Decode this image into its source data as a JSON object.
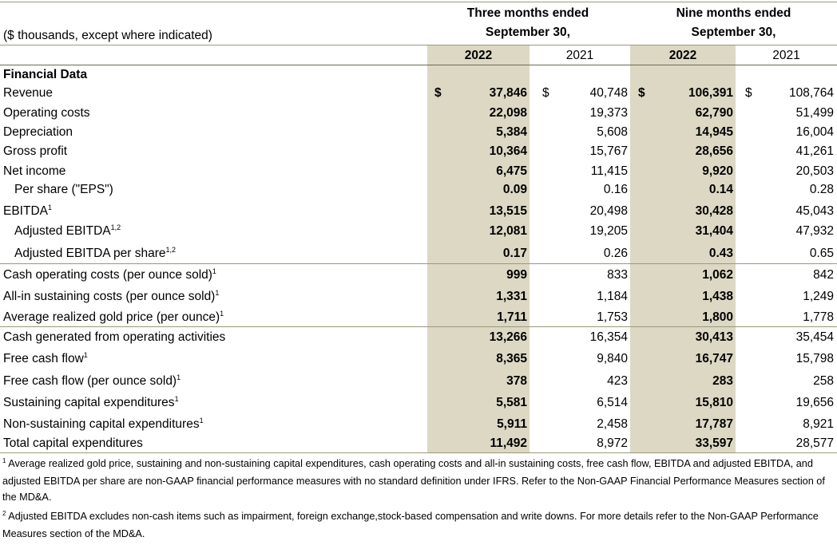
{
  "header": {
    "units_label": "($ thousands, except where indicated)",
    "three_months_line1": "Three months ended",
    "three_months_line2": "September 30,",
    "nine_months_line1": "Nine months ended",
    "nine_months_line2": "September 30,",
    "years": [
      "2022",
      "2021",
      "2022",
      "2021"
    ]
  },
  "colors": {
    "shade": "#dcd8c4",
    "rule": "#9a9a7a"
  },
  "section_title": "Financial Data",
  "currency_symbol": "$",
  "rows": [
    {
      "label": "Revenue",
      "sup": "",
      "indent": false,
      "currency": true,
      "values": [
        "37,846",
        "40,748",
        "106,391",
        "108,764"
      ]
    },
    {
      "label": "Operating costs",
      "sup": "",
      "indent": false,
      "currency": false,
      "values": [
        "22,098",
        "19,373",
        "62,790",
        "51,499"
      ]
    },
    {
      "label": "Depreciation",
      "sup": "",
      "indent": false,
      "currency": false,
      "values": [
        "5,384",
        "5,608",
        "14,945",
        "16,004"
      ]
    },
    {
      "label": "Gross profit",
      "sup": "",
      "indent": false,
      "currency": false,
      "values": [
        "10,364",
        "15,767",
        "28,656",
        "41,261"
      ]
    },
    {
      "label": "Net income",
      "sup": "",
      "indent": false,
      "currency": false,
      "values": [
        "6,475",
        "11,415",
        "9,920",
        "20,503"
      ]
    },
    {
      "label": "Per share (\"EPS\")",
      "sup": "",
      "indent": true,
      "currency": false,
      "values": [
        "0.09",
        "0.16",
        "0.14",
        "0.28"
      ]
    },
    {
      "label": "EBITDA",
      "sup": "1",
      "indent": false,
      "currency": false,
      "values": [
        "13,515",
        "20,498",
        "30,428",
        "45,043"
      ]
    },
    {
      "label": "Adjusted EBITDA",
      "sup": "1,2",
      "indent": true,
      "currency": false,
      "values": [
        "12,081",
        "19,205",
        "31,404",
        "47,932"
      ]
    },
    {
      "label": "Adjusted EBITDA per share",
      "sup": "1,2",
      "indent": true,
      "currency": false,
      "values": [
        "0.17",
        "0.26",
        "0.43",
        "0.65"
      ]
    },
    {
      "label": "Cash operating costs (per ounce sold)",
      "sup": "1",
      "indent": false,
      "currency": false,
      "values": [
        "999",
        "833",
        "1,062",
        "842"
      ]
    },
    {
      "label": "All-in sustaining costs (per ounce sold)",
      "sup": "1",
      "indent": false,
      "currency": false,
      "values": [
        "1,331",
        "1,184",
        "1,438",
        "1,249"
      ]
    },
    {
      "label": "Average realized gold price (per ounce)",
      "sup": "1",
      "indent": false,
      "currency": false,
      "values": [
        "1,711",
        "1,753",
        "1,800",
        "1,778"
      ]
    },
    {
      "label": "Cash generated from operating activities",
      "sup": "",
      "indent": false,
      "currency": false,
      "values": [
        "13,266",
        "16,354",
        "30,413",
        "35,454"
      ]
    },
    {
      "label": "Free cash flow",
      "sup": "1",
      "indent": false,
      "currency": false,
      "values": [
        "8,365",
        "9,840",
        "16,747",
        "15,798"
      ]
    },
    {
      "label": "Free cash flow (per ounce sold)",
      "sup": "1",
      "indent": false,
      "currency": false,
      "values": [
        "378",
        "423",
        "283",
        "258"
      ]
    },
    {
      "label": "Sustaining capital expenditures",
      "sup": "1",
      "indent": false,
      "currency": false,
      "values": [
        "5,581",
        "6,514",
        "15,810",
        "19,656"
      ]
    },
    {
      "label": "Non-sustaining capital expenditures",
      "sup": "1",
      "indent": false,
      "currency": false,
      "values": [
        "5,911",
        "2,458",
        "17,787",
        "8,921"
      ]
    },
    {
      "label": "Total capital expenditures",
      "sup": "",
      "indent": false,
      "currency": false,
      "values": [
        "11,492",
        "8,972",
        "33,597",
        "28,577"
      ]
    }
  ],
  "footnotes": [
    {
      "marker": "1",
      "text": "Average realized gold price, sustaining and non-sustaining capital expenditures, cash operating costs and all-in sustaining costs, free cash flow, EBITDA and adjusted EBITDA, and adjusted EBITDA per share are non-GAAP financial performance measures with no standard definition under IFRS. Refer to the Non-GAAP Financial Performance Measures section of the MD&A."
    },
    {
      "marker": "2",
      "text": "Adjusted EBITDA excludes non-cash items such as impairment, foreign exchange,stock-based compensation and write downs. For more details refer to the Non-GAAP Performance Measures section of the MD&A."
    }
  ]
}
